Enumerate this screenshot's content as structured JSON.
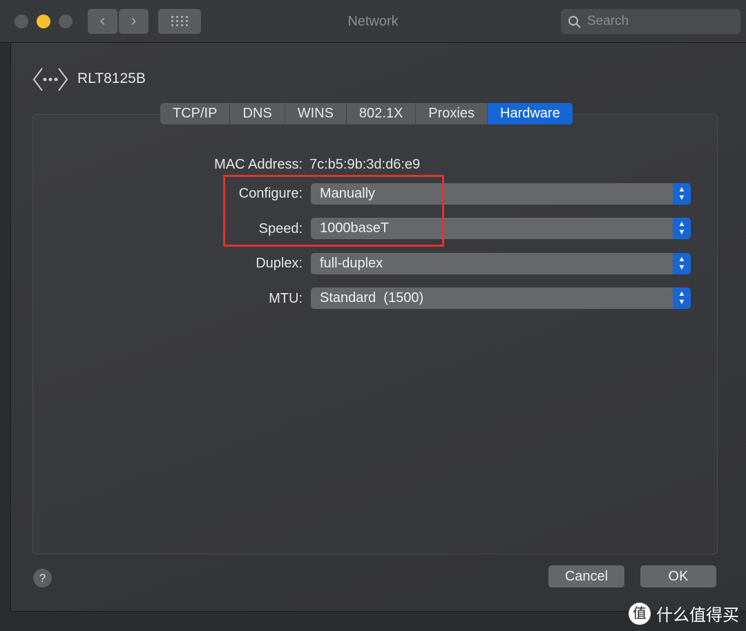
{
  "window": {
    "title": "Network",
    "search_placeholder": "Search",
    "back": "‹",
    "forward": "›"
  },
  "device": {
    "name": "RLT8125B",
    "icon": "ethernet-icon"
  },
  "tabs": [
    {
      "label": "TCP/IP"
    },
    {
      "label": "DNS"
    },
    {
      "label": "WINS"
    },
    {
      "label": "802.1X"
    },
    {
      "label": "Proxies"
    },
    {
      "label": "Hardware",
      "active": true
    }
  ],
  "hardware": {
    "mac_label": "MAC Address:",
    "mac_value": "7c:b5:9b:3d:d6:e9",
    "configure_label": "Configure:",
    "configure_value": "Manually",
    "speed_label": "Speed:",
    "speed_value": "1000baseT",
    "duplex_label": "Duplex:",
    "duplex_value": "full-duplex",
    "mtu_label": "MTU:",
    "mtu_value": "Standard  (1500)"
  },
  "buttons": {
    "help": "?",
    "cancel": "Cancel",
    "ok": "OK"
  },
  "annotation": {
    "color": "#e0342a"
  },
  "watermark": {
    "logo": "值",
    "text": "什么值得买"
  },
  "colors": {
    "accent": "#1766d6",
    "minimize": "#f5c02c"
  }
}
